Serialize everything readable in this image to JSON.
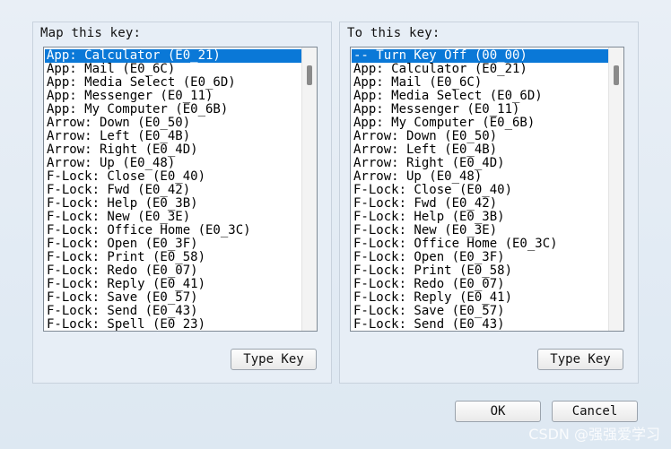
{
  "left": {
    "label": "Map this key:",
    "items": [
      "App: Calculator (E0_21)",
      "App: Mail (E0_6C)",
      "App: Media Select (E0_6D)",
      "App: Messenger (E0_11)",
      "App: My Computer (E0_6B)",
      "Arrow: Down (E0_50)",
      "Arrow: Left (E0_4B)",
      "Arrow: Right (E0_4D)",
      "Arrow: Up (E0_48)",
      "F-Lock: Close (E0_40)",
      "F-Lock: Fwd (E0_42)",
      "F-Lock: Help (E0_3B)",
      "F-Lock: New (E0_3E)",
      "F-Lock: Office Home (E0_3C)",
      "F-Lock: Open (E0_3F)",
      "F-Lock: Print (E0_58)",
      "F-Lock: Redo (E0_07)",
      "F-Lock: Reply (E0_41)",
      "F-Lock: Save (E0_57)",
      "F-Lock: Send (E0_43)",
      "F-Lock: Spell (E0_23)"
    ],
    "selected_index": 0,
    "button_label": "Type Key"
  },
  "right": {
    "label": "To this key:",
    "items": [
      "-- Turn Key Off (00_00)",
      "App: Calculator (E0_21)",
      "App: Mail (E0_6C)",
      "App: Media Select (E0_6D)",
      "App: Messenger (E0_11)",
      "App: My Computer (E0_6B)",
      "Arrow: Down (E0_50)",
      "Arrow: Left (E0_4B)",
      "Arrow: Right (E0_4D)",
      "Arrow: Up (E0_48)",
      "F-Lock: Close (E0_40)",
      "F-Lock: Fwd (E0_42)",
      "F-Lock: Help (E0_3B)",
      "F-Lock: New (E0_3E)",
      "F-Lock: Office Home (E0_3C)",
      "F-Lock: Open (E0_3F)",
      "F-Lock: Print (E0_58)",
      "F-Lock: Redo (E0_07)",
      "F-Lock: Reply (E0_41)",
      "F-Lock: Save (E0_57)",
      "F-Lock: Send (E0_43)"
    ],
    "selected_index": 0,
    "button_label": "Type Key"
  },
  "footer": {
    "ok_label": "OK",
    "cancel_label": "Cancel"
  },
  "watermark": "CSDN @强强爱学习",
  "colors": {
    "selection": "#0a78d7",
    "dialog_bg": "#e3ebf4"
  }
}
